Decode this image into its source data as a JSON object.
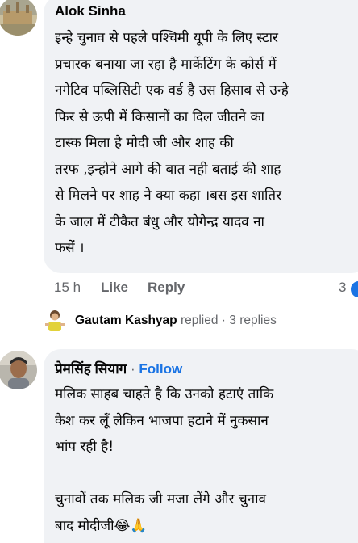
{
  "comment1": {
    "author": "Alok Sinha",
    "text": "इन्हे चुनाव से पहले पश्चिमी यूपी के लिए स्टार\nप्रचारक बनाया जा रहा है मार्केटिंग के कोर्स में\nनगेटिव पब्लिसिटी एक वर्ड है उस हिसाब से उन्हे\nफिर से ऊपी में किसानों का दिल जीतने का\nटास्क मिला है मोदी जी और शाह की\nतरफ ,इन्होने आगे की बात नही बताई की शाह\nसे मिलने पर शाह ने क्या कहा ।बस इस शातिर\nके जाल में टीकैत बंधु और योगेन्द्र यादव ना\nफसें ।",
    "time": "15 h",
    "like_label": "Like",
    "reply_label": "Reply",
    "reaction_count": "3",
    "reaction_icon": "like-badge-icon"
  },
  "replies_summary": {
    "name": "Gautam Kashyap",
    "replied_label": "replied",
    "separator": "·",
    "count_label": "3 replies"
  },
  "comment2": {
    "author": "प्रेमसिंह सियाग",
    "separator": "·",
    "follow_label": "Follow",
    "text": "मलिक साहब चाहते है कि उनको हटाएं ताकि\nकैश कर लूँ लेकिन भाजपा हटाने में नुकसान\nभांप रही है!\n\nचुनावों तक मलिक जी मजा लेंगे और चुनाव\nबाद मोदीजी😂🙏"
  },
  "colors": {
    "bubble": "#f0f2f5",
    "link_blue": "#1b74e4",
    "meta_gray": "#65676b"
  }
}
